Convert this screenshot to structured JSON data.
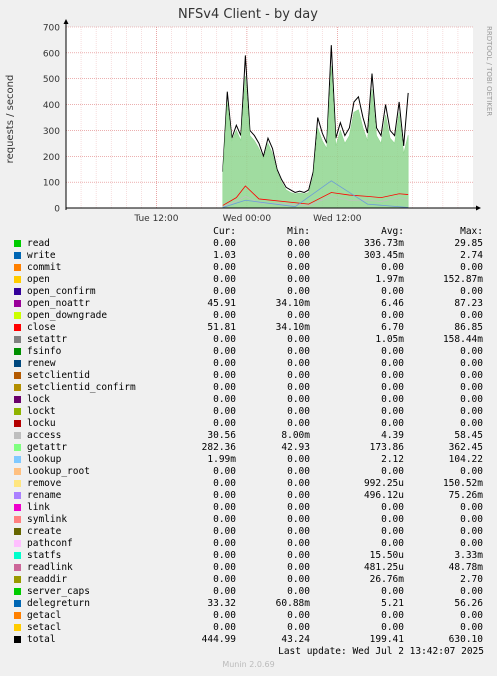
{
  "chart_data": {
    "type": "area",
    "title": "NFSv4 Client - by day",
    "ylabel": "requests / second",
    "watermark": "RRDTOOL / TOBI OETIKER",
    "ylim": [
      0,
      700
    ],
    "yticks": [
      0,
      100,
      200,
      300,
      400,
      500,
      600,
      700
    ],
    "xlim": [
      0,
      54
    ],
    "xticks": [
      {
        "label": "Tue 12:00",
        "value": 12
      },
      {
        "label": "Wed 00:00",
        "value": 24
      },
      {
        "label": "Wed 12:00",
        "value": 36
      }
    ],
    "xunit": "hours since Tue 00:00",
    "grid": true,
    "series": [
      {
        "name": "total",
        "color": "#000000",
        "type": "line",
        "x": [
          20.8,
          21.4,
          22,
          22.6,
          23.2,
          23.8,
          24.4,
          25,
          25.6,
          26.2,
          26.8,
          27.4,
          28,
          28.6,
          29.2,
          29.8,
          30.4,
          31,
          31.6,
          32.2,
          32.8,
          33.4,
          34,
          34.6,
          35.2,
          35.8,
          36.4,
          37,
          37.6,
          38.2,
          38.8,
          39.4,
          40,
          40.6,
          41.2,
          41.8,
          42.4,
          43,
          43.6,
          44.2,
          44.8,
          45.4
        ],
        "values": [
          140,
          450,
          270,
          320,
          280,
          590,
          300,
          280,
          250,
          200,
          270,
          230,
          150,
          110,
          80,
          70,
          60,
          65,
          60,
          70,
          140,
          350,
          290,
          250,
          630,
          270,
          330,
          280,
          310,
          410,
          430,
          350,
          290,
          520,
          310,
          280,
          400,
          300,
          280,
          410,
          240,
          445
        ]
      },
      {
        "name": "getattr",
        "color": "#8fd68f",
        "type": "area",
        "x": [
          20.8,
          21.4,
          22,
          22.6,
          23.2,
          23.8,
          24.4,
          25,
          25.6,
          26.2,
          26.8,
          27.4,
          28,
          28.6,
          29.2,
          29.8,
          30.4,
          31,
          31.6,
          32.2,
          32.8,
          33.4,
          34,
          34.6,
          35.2,
          35.8,
          36.4,
          37,
          37.6,
          38.2,
          38.8,
          39.4,
          40,
          40.6,
          41.2,
          41.8,
          42.4,
          43,
          43.6,
          44.2,
          44.8,
          45.4
        ],
        "values": [
          130,
          410,
          260,
          300,
          260,
          510,
          280,
          260,
          230,
          190,
          250,
          210,
          140,
          100,
          70,
          60,
          55,
          58,
          55,
          60,
          120,
          310,
          260,
          230,
          550,
          240,
          300,
          250,
          280,
          370,
          380,
          310,
          260,
          460,
          280,
          250,
          360,
          270,
          250,
          370,
          210,
          282
        ]
      },
      {
        "name": "close",
        "color": "#ff0000",
        "type": "line",
        "x": [
          20.8,
          22.6,
          23.8,
          25.6,
          32.2,
          35.2,
          37.6,
          40,
          41.8,
          44.2,
          45.4
        ],
        "values": [
          10,
          40,
          85,
          35,
          15,
          60,
          50,
          45,
          40,
          55,
          52
        ]
      },
      {
        "name": "access",
        "color": "#bfbfbf",
        "type": "line",
        "x": [
          20.8,
          22.6,
          23.8,
          25.6,
          32.2,
          35.2,
          37.6,
          40,
          41.8,
          44.2,
          45.4
        ],
        "values": [
          5,
          25,
          45,
          20,
          10,
          45,
          30,
          30,
          25,
          40,
          31
        ]
      },
      {
        "name": "lookup",
        "color": "#6b9bd9",
        "type": "line",
        "x": [
          20.8,
          23.8,
          30.4,
          35.2,
          40,
          45.4
        ],
        "values": [
          2,
          30,
          5,
          105,
          15,
          2
        ]
      }
    ]
  },
  "legend": {
    "headers": [
      "Cur:",
      "Min:",
      "Avg:",
      "Max:"
    ],
    "rows": [
      {
        "name": "read",
        "color": "#00cc00",
        "cur": "0.00",
        "min": "0.00",
        "avg": "336.73m",
        "max": "29.85"
      },
      {
        "name": "write",
        "color": "#0066b3",
        "cur": "1.03",
        "min": "0.00",
        "avg": "303.45m",
        "max": "2.74"
      },
      {
        "name": "commit",
        "color": "#ff8000",
        "cur": "0.00",
        "min": "0.00",
        "avg": "0.00",
        "max": "0.00"
      },
      {
        "name": "open",
        "color": "#ffcc00",
        "cur": "0.00",
        "min": "0.00",
        "avg": "1.97m",
        "max": "152.87m"
      },
      {
        "name": "open_confirm",
        "color": "#330099",
        "cur": "0.00",
        "min": "0.00",
        "avg": "0.00",
        "max": "0.00"
      },
      {
        "name": "open_noattr",
        "color": "#990099",
        "cur": "45.91",
        "min": "34.10m",
        "avg": "6.46",
        "max": "87.23"
      },
      {
        "name": "open_downgrade",
        "color": "#ccff00",
        "cur": "0.00",
        "min": "0.00",
        "avg": "0.00",
        "max": "0.00"
      },
      {
        "name": "close",
        "color": "#ff0000",
        "cur": "51.81",
        "min": "34.10m",
        "avg": "6.70",
        "max": "86.85"
      },
      {
        "name": "setattr",
        "color": "#808080",
        "cur": "0.00",
        "min": "0.00",
        "avg": "1.05m",
        "max": "158.44m"
      },
      {
        "name": "fsinfo",
        "color": "#008f00",
        "cur": "0.00",
        "min": "0.00",
        "avg": "0.00",
        "max": "0.00"
      },
      {
        "name": "renew",
        "color": "#00487d",
        "cur": "0.00",
        "min": "0.00",
        "avg": "0.00",
        "max": "0.00"
      },
      {
        "name": "setclientid",
        "color": "#b35a00",
        "cur": "0.00",
        "min": "0.00",
        "avg": "0.00",
        "max": "0.00"
      },
      {
        "name": "setclientid_confirm",
        "color": "#b38f00",
        "cur": "0.00",
        "min": "0.00",
        "avg": "0.00",
        "max": "0.00"
      },
      {
        "name": "lock",
        "color": "#6b006b",
        "cur": "0.00",
        "min": "0.00",
        "avg": "0.00",
        "max": "0.00"
      },
      {
        "name": "lockt",
        "color": "#8fb300",
        "cur": "0.00",
        "min": "0.00",
        "avg": "0.00",
        "max": "0.00"
      },
      {
        "name": "locku",
        "color": "#b30000",
        "cur": "0.00",
        "min": "0.00",
        "avg": "0.00",
        "max": "0.00"
      },
      {
        "name": "access",
        "color": "#bebebe",
        "cur": "30.56",
        "min": "8.00m",
        "avg": "4.39",
        "max": "58.45"
      },
      {
        "name": "getattr",
        "color": "#80ff80",
        "cur": "282.36",
        "min": "42.93",
        "avg": "173.86",
        "max": "362.45"
      },
      {
        "name": "lookup",
        "color": "#80c9ff",
        "cur": "1.99m",
        "min": "0.00",
        "avg": "2.12",
        "max": "104.22"
      },
      {
        "name": "lookup_root",
        "color": "#ffc080",
        "cur": "0.00",
        "min": "0.00",
        "avg": "0.00",
        "max": "0.00"
      },
      {
        "name": "remove",
        "color": "#ffe680",
        "cur": "0.00",
        "min": "0.00",
        "avg": "992.25u",
        "max": "150.52m"
      },
      {
        "name": "rename",
        "color": "#aa80ff",
        "cur": "0.00",
        "min": "0.00",
        "avg": "496.12u",
        "max": "75.26m"
      },
      {
        "name": "link",
        "color": "#ee00cc",
        "cur": "0.00",
        "min": "0.00",
        "avg": "0.00",
        "max": "0.00"
      },
      {
        "name": "symlink",
        "color": "#ff8080",
        "cur": "0.00",
        "min": "0.00",
        "avg": "0.00",
        "max": "0.00"
      },
      {
        "name": "create",
        "color": "#666600",
        "cur": "0.00",
        "min": "0.00",
        "avg": "0.00",
        "max": "0.00"
      },
      {
        "name": "pathconf",
        "color": "#ffbfff",
        "cur": "0.00",
        "min": "0.00",
        "avg": "0.00",
        "max": "0.00"
      },
      {
        "name": "statfs",
        "color": "#00ffcc",
        "cur": "0.00",
        "min": "0.00",
        "avg": "15.50u",
        "max": "3.33m"
      },
      {
        "name": "readlink",
        "color": "#cc6699",
        "cur": "0.00",
        "min": "0.00",
        "avg": "481.25u",
        "max": "48.78m"
      },
      {
        "name": "readdir",
        "color": "#999900",
        "cur": "0.00",
        "min": "0.00",
        "avg": "26.76m",
        "max": "2.70"
      },
      {
        "name": "server_caps",
        "color": "#00cc00",
        "cur": "0.00",
        "min": "0.00",
        "avg": "0.00",
        "max": "0.00"
      },
      {
        "name": "delegreturn",
        "color": "#0066b3",
        "cur": "33.32",
        "min": "60.88m",
        "avg": "5.21",
        "max": "56.26"
      },
      {
        "name": "getacl",
        "color": "#ff8000",
        "cur": "0.00",
        "min": "0.00",
        "avg": "0.00",
        "max": "0.00"
      },
      {
        "name": "setacl",
        "color": "#ffcc00",
        "cur": "0.00",
        "min": "0.00",
        "avg": "0.00",
        "max": "0.00"
      },
      {
        "name": "total",
        "color": "#000000",
        "cur": "444.99",
        "min": "43.24",
        "avg": "199.41",
        "max": "630.10"
      }
    ]
  },
  "footer": {
    "last_update": "Last update: Wed Jul  2 13:42:07 2025",
    "version": "Munin 2.0.69"
  }
}
